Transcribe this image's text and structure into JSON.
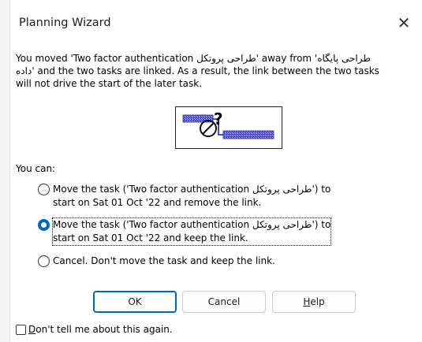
{
  "dialog": {
    "title": "Planning Wizard",
    "close_glyph": "✕",
    "message_lines": [
      "You moved 'Two factor authentication طراحی پروتکل' away from 'طراحی پایگاه",
      "داده' and the two tasks are linked.  As a result, the link between the two tasks",
      "will not drive the start of the later task."
    ],
    "illustration_icon": "link-conflict-icon",
    "you_can_label": "You can:",
    "options": [
      {
        "line1": "Move the task ('Two factor authentication طراحی پروتکل') to",
        "line2": "start on Sat 01 Oct '22 and remove the link.",
        "checked": false
      },
      {
        "line1": "Move the task ('Two factor authentication طراحی پروتکل') to",
        "line2": "start on Sat 01 Oct '22 and keep the link.",
        "checked": true
      },
      {
        "line1": "Cancel.  Don't move the task and keep the link.",
        "line2": "",
        "checked": false
      }
    ],
    "buttons": {
      "ok": "OK",
      "cancel": "Cancel",
      "help_first": "H",
      "help_rest": "elp"
    },
    "dont_tell": {
      "first": "D",
      "rest": "on't tell me about this again.",
      "checked": false
    },
    "accent_color": "#0067c0"
  }
}
